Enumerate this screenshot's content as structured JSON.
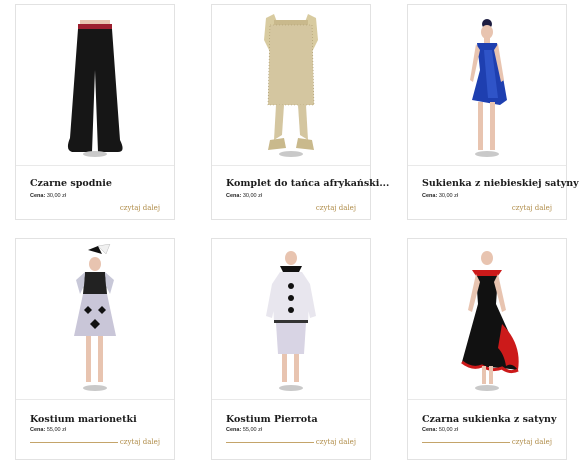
{
  "products": [
    {
      "title": "Czarne spodnie",
      "price_label": "Cena:",
      "price": "30,00 zł",
      "more": "czytaj dalej",
      "image_name": "black-trousers-image",
      "show_line": false
    },
    {
      "title": "Komplet do tańca afrykański...",
      "price_label": "Cena:",
      "price": "30,00 zł",
      "more": "czytaj dalej",
      "image_name": "african-dance-set-image",
      "show_line": false
    },
    {
      "title": "Sukienka z niebieskiej satyny",
      "price_label": "Cena:",
      "price": "30,00 zł",
      "more": "czytaj dalej",
      "image_name": "blue-satin-dress-image",
      "show_line": false
    },
    {
      "title": "Kostium marionetki",
      "price_label": "Cena:",
      "price": "55,00 zł",
      "more": "czytaj dalej",
      "image_name": "marionette-costume-image",
      "show_line": true
    },
    {
      "title": "Kostium Pierrota",
      "price_label": "Cena:",
      "price": "55,00 zł",
      "more": "czytaj dalej",
      "image_name": "pierrot-costume-image",
      "show_line": true
    },
    {
      "title": "Czarna sukienka z satyny",
      "price_label": "Cena:",
      "price": "50,00 zł",
      "more": "czytaj dalej",
      "image_name": "black-satin-dress-image",
      "show_line": true
    }
  ],
  "colors": {
    "accent": "#b08d4a",
    "border": "#e2e2e2",
    "title": "#1c1c1c"
  }
}
